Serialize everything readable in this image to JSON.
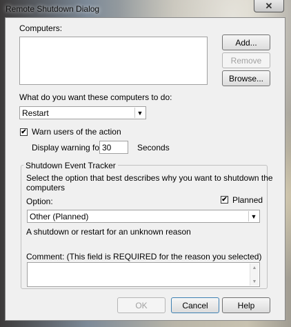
{
  "window": {
    "title": "Remote Shutdown Dialog",
    "close_glyph": "✕"
  },
  "computers": {
    "label": "Computers:",
    "add_label": "Add...",
    "remove_label": "Remove",
    "browse_label": "Browse..."
  },
  "action": {
    "label": "What do you want these computers to do:",
    "selected": "Restart"
  },
  "warn": {
    "checkbox_label": "Warn users of the action",
    "checked": true,
    "display_label": "Display warning for",
    "seconds_value": "30",
    "seconds_unit": "Seconds"
  },
  "tracker": {
    "group_title": "Shutdown Event Tracker",
    "instructions_line1": "Select the option that best describes why you want to shutdown the",
    "instructions_line2": "computers",
    "option_label": "Option:",
    "planned_label": "Planned",
    "planned_checked": true,
    "option_selected": "Other (Planned)",
    "description": "A shutdown or restart for an unknown reason",
    "comment_label": "Comment:  (This field is REQUIRED for the reason you selected)",
    "comment_value": ""
  },
  "footer": {
    "ok_label": "OK",
    "cancel_label": "Cancel",
    "help_label": "Help"
  },
  "icons": {
    "check_glyph": "✔",
    "dropdown_glyph": "▼",
    "scroll_up_glyph": "▲",
    "scroll_down_glyph": "▼"
  }
}
